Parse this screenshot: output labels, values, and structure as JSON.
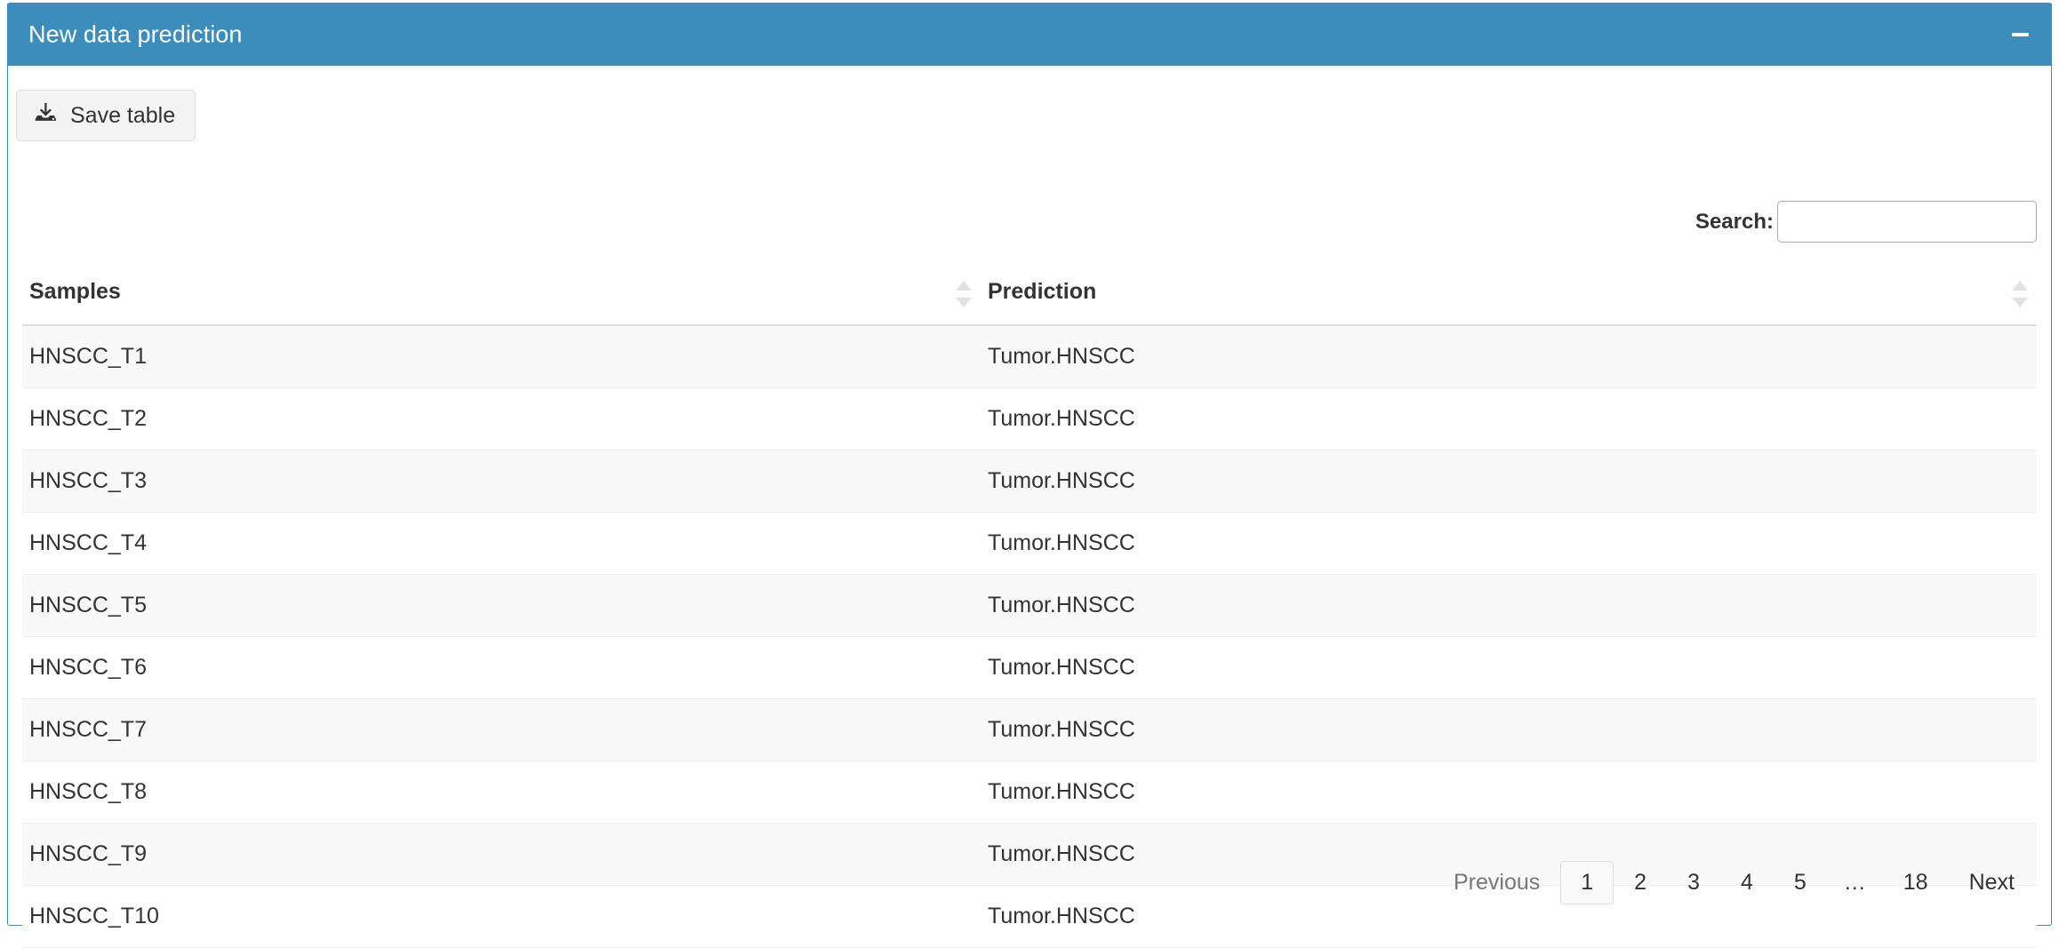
{
  "panel": {
    "title": "New data prediction",
    "header_color": "#3c8dbc",
    "minimize_icon": "minus-icon"
  },
  "toolbar": {
    "save_label": "Save table",
    "save_icon": "download-icon"
  },
  "search": {
    "label": "Search:",
    "value": "",
    "placeholder": ""
  },
  "table": {
    "columns": [
      {
        "label": "Samples",
        "sort_icon": "sort-both-icon"
      },
      {
        "label": "Prediction",
        "sort_icon": "sort-both-icon"
      }
    ],
    "rows": [
      {
        "sample": "HNSCC_T1",
        "prediction": "Tumor.HNSCC"
      },
      {
        "sample": "HNSCC_T2",
        "prediction": "Tumor.HNSCC"
      },
      {
        "sample": "HNSCC_T3",
        "prediction": "Tumor.HNSCC"
      },
      {
        "sample": "HNSCC_T4",
        "prediction": "Tumor.HNSCC"
      },
      {
        "sample": "HNSCC_T5",
        "prediction": "Tumor.HNSCC"
      },
      {
        "sample": "HNSCC_T6",
        "prediction": "Tumor.HNSCC"
      },
      {
        "sample": "HNSCC_T7",
        "prediction": "Tumor.HNSCC"
      },
      {
        "sample": "HNSCC_T8",
        "prediction": "Tumor.HNSCC"
      },
      {
        "sample": "HNSCC_T9",
        "prediction": "Tumor.HNSCC"
      },
      {
        "sample": "HNSCC_T10",
        "prediction": "Tumor.HNSCC"
      }
    ]
  },
  "pagination": {
    "previous_label": "Previous",
    "next_label": "Next",
    "ellipsis": "…",
    "current_page": "1",
    "pages": [
      "1",
      "2",
      "3",
      "4",
      "5",
      "…",
      "18"
    ]
  }
}
